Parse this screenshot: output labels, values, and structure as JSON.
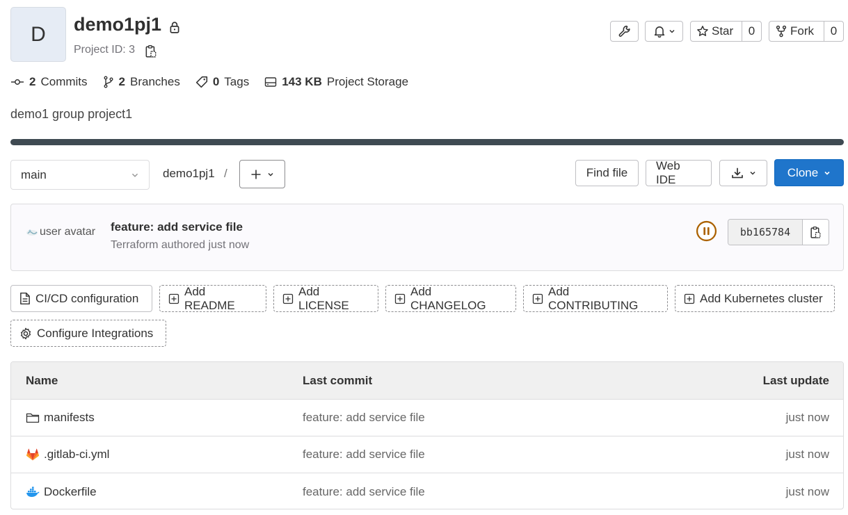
{
  "project": {
    "avatar_letter": "D",
    "name": "demo1pj1",
    "project_id_text": "Project ID: 3",
    "description": "demo1 group project1"
  },
  "header_actions": {
    "star_label": "Star",
    "star_count": "0",
    "fork_label": "Fork",
    "fork_count": "0"
  },
  "stats": {
    "commits_count": "2",
    "commits_label": "Commits",
    "branches_count": "2",
    "branches_label": "Branches",
    "tags_count": "0",
    "tags_label": "Tags",
    "storage_size": "143 KB",
    "storage_label": "Project Storage"
  },
  "repo": {
    "branch": "main",
    "breadcrumb_project": "demo1pj1",
    "breadcrumb_separator": "/",
    "find_file_label": "Find file",
    "web_ide_label": "Web IDE",
    "clone_label": "Clone"
  },
  "last_commit": {
    "avatar_alt": "user avatar",
    "title": "feature: add service file",
    "meta": "Terraform authored just now",
    "sha": "bb165784"
  },
  "quick_actions": [
    {
      "label": "CI/CD configuration"
    },
    {
      "label": "Add README"
    },
    {
      "label": "Add LICENSE"
    },
    {
      "label": "Add CHANGELOG"
    },
    {
      "label": "Add CONTRIBUTING"
    },
    {
      "label": "Add Kubernetes cluster"
    },
    {
      "label": "Configure Integrations"
    }
  ],
  "files": {
    "headers": {
      "name": "Name",
      "last_commit": "Last commit",
      "last_update": "Last update"
    },
    "rows": [
      {
        "name": "manifests",
        "icon": "folder-icon",
        "commit": "feature: add service file",
        "updated": "just now"
      },
      {
        "name": ".gitlab-ci.yml",
        "icon": "gitlab-icon",
        "commit": "feature: add service file",
        "updated": "just now"
      },
      {
        "name": "Dockerfile",
        "icon": "docker-icon",
        "commit": "feature: add service file",
        "updated": "just now"
      }
    ]
  },
  "colors": {
    "primary": "#1f75cb",
    "progress": "#3f4a52",
    "pipeline": "#ab6100",
    "gitlab_orange": "#e24329",
    "docker_blue": "#2496ed"
  }
}
